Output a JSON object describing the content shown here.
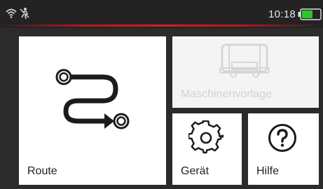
{
  "status": {
    "time": "10:18",
    "wifi_icon": "wifi-icon",
    "sync_icon": "no-sync-icon",
    "battery_icon": "battery-icon",
    "battery_level": 0.6,
    "battery_color": "#2cc62c",
    "accent_color": "#d41d2a"
  },
  "tiles": {
    "route": {
      "label": "Route",
      "icon": "route-icon"
    },
    "template": {
      "label": "Maschinenvorlage",
      "icon": "machine-icon",
      "enabled": false
    },
    "device": {
      "label": "Gerät",
      "icon": "gear-icon"
    },
    "help": {
      "label": "Hilfe",
      "icon": "help-icon"
    }
  }
}
